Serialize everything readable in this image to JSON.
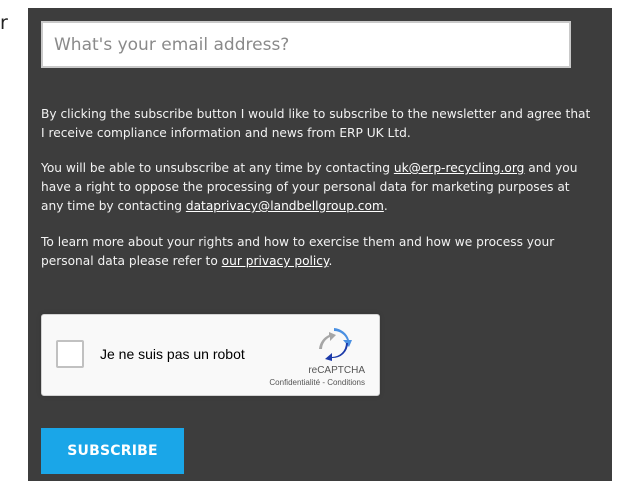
{
  "left_fragment": "r",
  "form": {
    "email_placeholder": "What's your email address?",
    "email_value": ""
  },
  "consent": {
    "paragraph_1": "By clicking the subscribe button I would like to subscribe to the newsletter and agree that I receive compliance information and news from ERP UK Ltd.",
    "paragraph_2_part_1": "You will be able to unsubscribe at any time by contacting ",
    "paragraph_2_link_1": "uk@erp-recycling.org",
    "paragraph_2_part_2": " and you have a right to oppose the processing of your personal data for marketing purposes at any time by contacting ",
    "paragraph_2_link_2": "dataprivacy@landbellgroup.com",
    "paragraph_2_part_3": ".",
    "paragraph_3_part_1": "To learn more about your rights and how to exercise them and how we process your personal data please refer to ",
    "paragraph_3_link": "our privacy policy",
    "paragraph_3_part_2": "."
  },
  "recaptcha": {
    "label": "Je ne suis pas un robot",
    "brand": "reCAPTCHA",
    "terms": "Confidentialité - Conditions",
    "logo_icon": "recaptcha-logo-icon"
  },
  "subscribe_label": "SUBSCRIBE",
  "colors": {
    "panel_bg": "#3d3d3d",
    "button_bg": "#1aa6e8"
  }
}
